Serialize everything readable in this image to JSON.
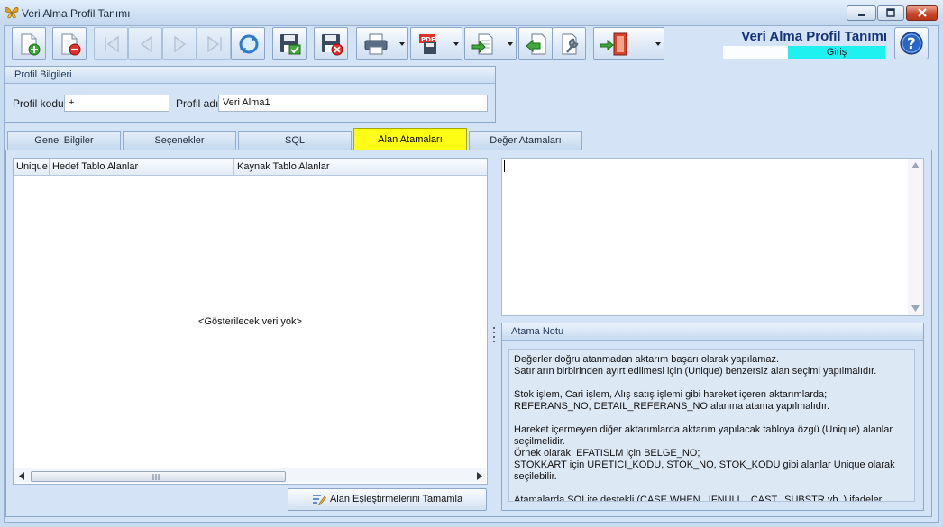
{
  "window": {
    "title": "Veri Alma Profil Tanımı"
  },
  "header": {
    "title": "Veri Alma Profil Tanımı",
    "mode": "Giriş",
    "accent_color": "#1ff0f0"
  },
  "toolbar": {
    "icons": [
      "new-record-icon",
      "delete-record-icon",
      "first-record-icon",
      "previous-record-icon",
      "next-record-icon",
      "last-record-icon",
      "refresh-icon",
      "save-icon",
      "cancel-save-icon",
      "print-icon",
      "pdf-export-icon",
      "import-icon",
      "back-icon",
      "settings-icon",
      "exit-icon",
      "help-icon"
    ]
  },
  "profil": {
    "group_title": "Profil Bilgileri",
    "code_label": "Profil kodu",
    "code_value": "+",
    "name_label": "Profil adı",
    "name_value": "Veri Alma1"
  },
  "tabs": [
    {
      "label": "Genel Bilgiler",
      "active": false
    },
    {
      "label": "Seçenekler",
      "active": false
    },
    {
      "label": "SQL",
      "active": false
    },
    {
      "label": "Alan Atamaları",
      "active": true
    },
    {
      "label": "Değer Atamaları",
      "active": false
    }
  ],
  "active_tab_color": "#fdfd15",
  "grid": {
    "columns": [
      "Unique",
      "Hedef Tablo Alanlar",
      "Kaynak Tablo Alanlar"
    ],
    "empty_text": "<Gösterilecek veri yok>"
  },
  "actions": {
    "finish_label": "Alan Eşleştirmelerini Tamamla"
  },
  "sql_editor": {
    "value": ""
  },
  "note": {
    "title": "Atama Notu",
    "paragraphs": [
      "Değerler doğru atanmadan aktarım başarı olarak yapılamaz.\nSatırların birbirinden ayırt edilmesi için (Unique) benzersiz alan seçimi yapılmalıdır.",
      "Stok işlem, Cari işlem, Alış satış işlemi gibi hareket içeren aktarımlarda;\nREFERANS_NO, DETAIL_REFERANS_NO alanına atama yapılmalıdır.",
      "Hareket içermeyen diğer aktarımlarda aktarım yapılacak tabloya özgü (Unique) alanlar seçilmelidir.\nÖrnek olarak: EFATISLM için BELGE_NO;\nSTOKKART için URETICI_KODU, STOK_NO, STOK_KODU gibi alanlar Unique olarak seçilebilir.",
      "Atamalarda SQLite destekli (CASE WHEN...IFNULL...CAST...SUBSTR vb..) ifadeler yazılabilir."
    ]
  }
}
